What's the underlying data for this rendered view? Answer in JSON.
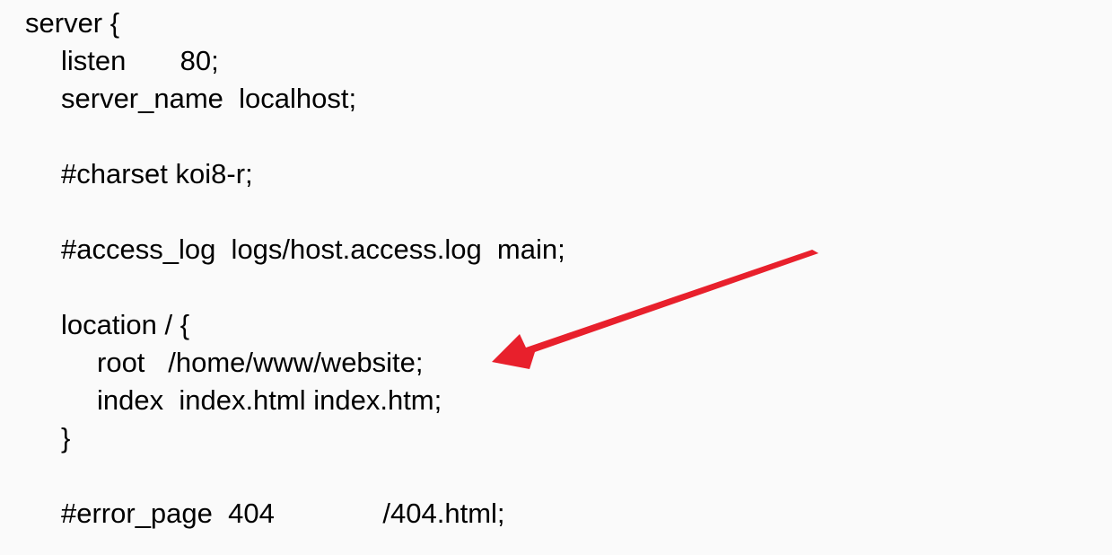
{
  "code": {
    "lines": [
      "server {",
      "listen       80;",
      "server_name  localhost;",
      "",
      "#charset koi8-r;",
      "",
      "#access_log  logs/host.access.log  main;",
      "",
      "location / {",
      "root   /home/www/website;",
      "index  index.html index.htm;",
      "}",
      "",
      "#error_page  404              /404.html;"
    ]
  },
  "annotation": {
    "arrow_color": "#e8202c",
    "arrow_icon": "red-arrow-icon"
  }
}
